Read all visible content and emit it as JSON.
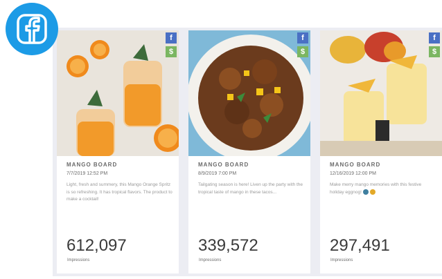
{
  "badge_icon": "facebook-icon",
  "cards": [
    {
      "board": "MANGO BOARD",
      "date": "7/7/2019 12:52 PM",
      "caption": "Light, fresh and summery, this Mango Orange Spritz is so refreshing. It has tropical flavors. The product to make a cocktail!",
      "impressions": "612,097",
      "impressions_label": "Impressions",
      "badge_fb": "f",
      "badge_money": "$"
    },
    {
      "board": "MANGO BOARD",
      "date": "8/9/2019 7:00 PM",
      "caption": "Tailgating season is here! Liven up the party with the tropical taste of mango in these tacos...",
      "impressions": "339,572",
      "impressions_label": "Impressions",
      "badge_fb": "f",
      "badge_money": "$"
    },
    {
      "board": "MANGO BOARD",
      "date": "12/16/2019 12:00 PM",
      "caption": "Make merry mango memories with this festive holiday eggnog!",
      "impressions": "297,491",
      "impressions_label": "Impressions",
      "badge_fb": "f",
      "badge_money": "$"
    }
  ],
  "colors": {
    "facebook_blue": "#1c9be6",
    "fb_badge": "#4a70c4",
    "money_badge": "#7bb661",
    "panel": "#ecedf3"
  }
}
